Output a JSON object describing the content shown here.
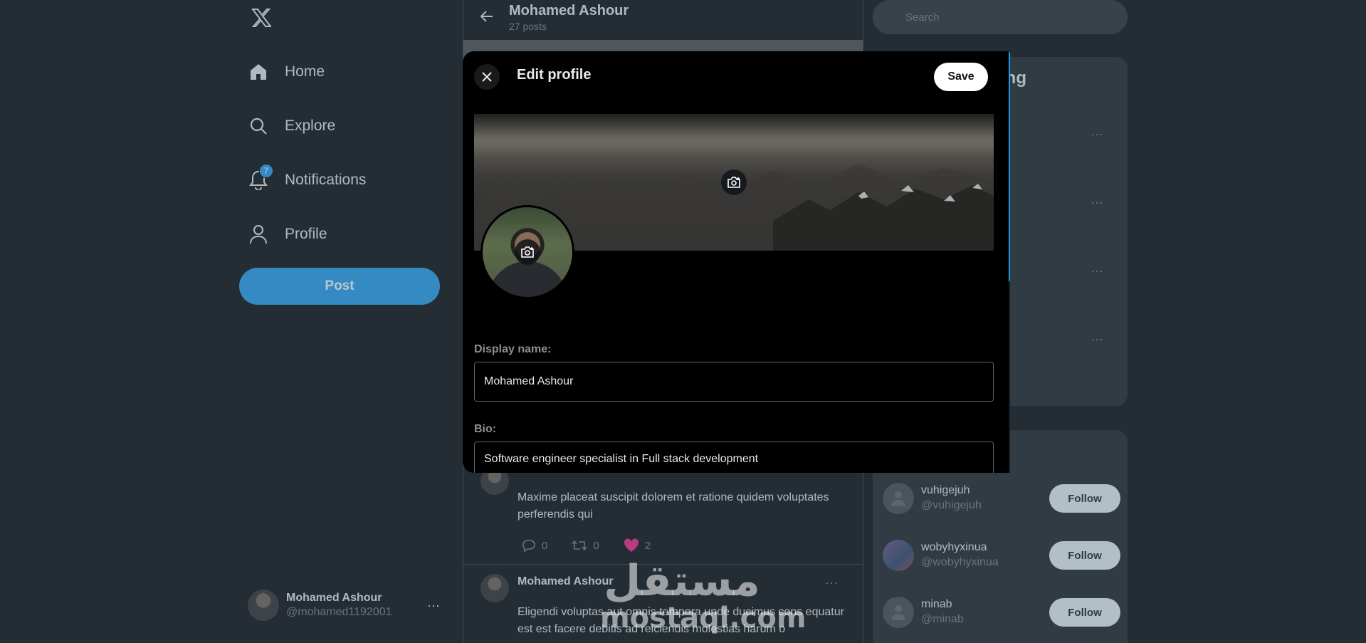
{
  "sidebar": {
    "nav": [
      {
        "label": "Home",
        "icon": "home-icon"
      },
      {
        "label": "Explore",
        "icon": "search-icon"
      },
      {
        "label": "Notifications",
        "icon": "bell-icon",
        "badge": "7"
      },
      {
        "label": "Profile",
        "icon": "user-icon"
      }
    ],
    "post_label": "Post",
    "account": {
      "name": "Mohamed Ashour",
      "handle": "@mohamed1192001",
      "more": "···"
    }
  },
  "header": {
    "title": "Mohamed Ashour",
    "subtitle": "27 posts"
  },
  "feed": [
    {
      "body": "Maxime placeat suscipit dolorem et ratione quidem voluptates perferendis qui",
      "replies": "0",
      "reposts": "0",
      "likes": "2"
    },
    {
      "author": "Mohamed Ashour",
      "body": "Eligendi voluptas aut omnis tempora unde ducimus cons equatur est est facere debitis ad reiciendis molestias harum o",
      "more": "···"
    }
  ],
  "right": {
    "search_placeholder": "Search",
    "trend_title_fragment": "ing",
    "who_to_follow": [
      {
        "name": "vuhigejuh",
        "handle": "@vuhigejuh",
        "button": "Follow"
      },
      {
        "name": "wobyhyxinua",
        "handle": "@wobyhyxinua",
        "button": "Follow"
      },
      {
        "name": "minab",
        "handle": "@minab",
        "button": "Follow"
      }
    ]
  },
  "modal": {
    "title": "Edit profile",
    "save_label": "Save",
    "display_name_label": "Display name:",
    "display_name_value": "Mohamed Ashour",
    "bio_label": "Bio:",
    "bio_value": "Software engineer specialist in Full stack development"
  },
  "watermark": {
    "arabic": "مستقل",
    "latin": "mostaql.com"
  },
  "colors": {
    "accent": "#1d9bf0",
    "background": "#000000",
    "like": "#f91880",
    "overlay": "rgba(91,112,131,0.4)"
  }
}
